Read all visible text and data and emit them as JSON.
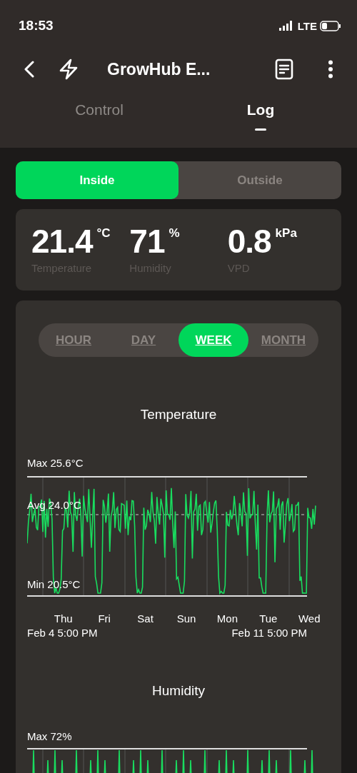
{
  "status_bar": {
    "time": "18:53",
    "network": "LTE"
  },
  "header": {
    "title": "GrowHub E..."
  },
  "tabs": [
    {
      "label": "Control",
      "selected": false
    },
    {
      "label": "Log",
      "selected": true
    }
  ],
  "location_switch": [
    {
      "label": "Inside",
      "selected": true
    },
    {
      "label": "Outside",
      "selected": false
    }
  ],
  "readings": [
    {
      "value": "21.4",
      "unit": "°C",
      "label": "Temperature"
    },
    {
      "value": "71",
      "unit": "%",
      "label": "Humidity"
    },
    {
      "value": "0.8",
      "unit": "kPa",
      "label": "VPD"
    }
  ],
  "periods": [
    {
      "label": "HOUR",
      "selected": false
    },
    {
      "label": "DAY",
      "selected": false
    },
    {
      "label": "WEEK",
      "selected": true
    },
    {
      "label": "MONTH",
      "selected": false
    }
  ],
  "charts": [
    {
      "title": "Temperature",
      "max_label": "Max 25.6°C",
      "avg_label": "Avg 24.0°C",
      "min_label": "Min 20.5°C",
      "days": [
        "Thu",
        "Fri",
        "Sat",
        "Sun",
        "Mon",
        "Tue",
        "Wed"
      ],
      "start": "Feb 4 5:00 PM",
      "end": "Feb 11 5:00 PM"
    },
    {
      "title": "Humidity",
      "max_label": "Max 72%"
    }
  ]
}
